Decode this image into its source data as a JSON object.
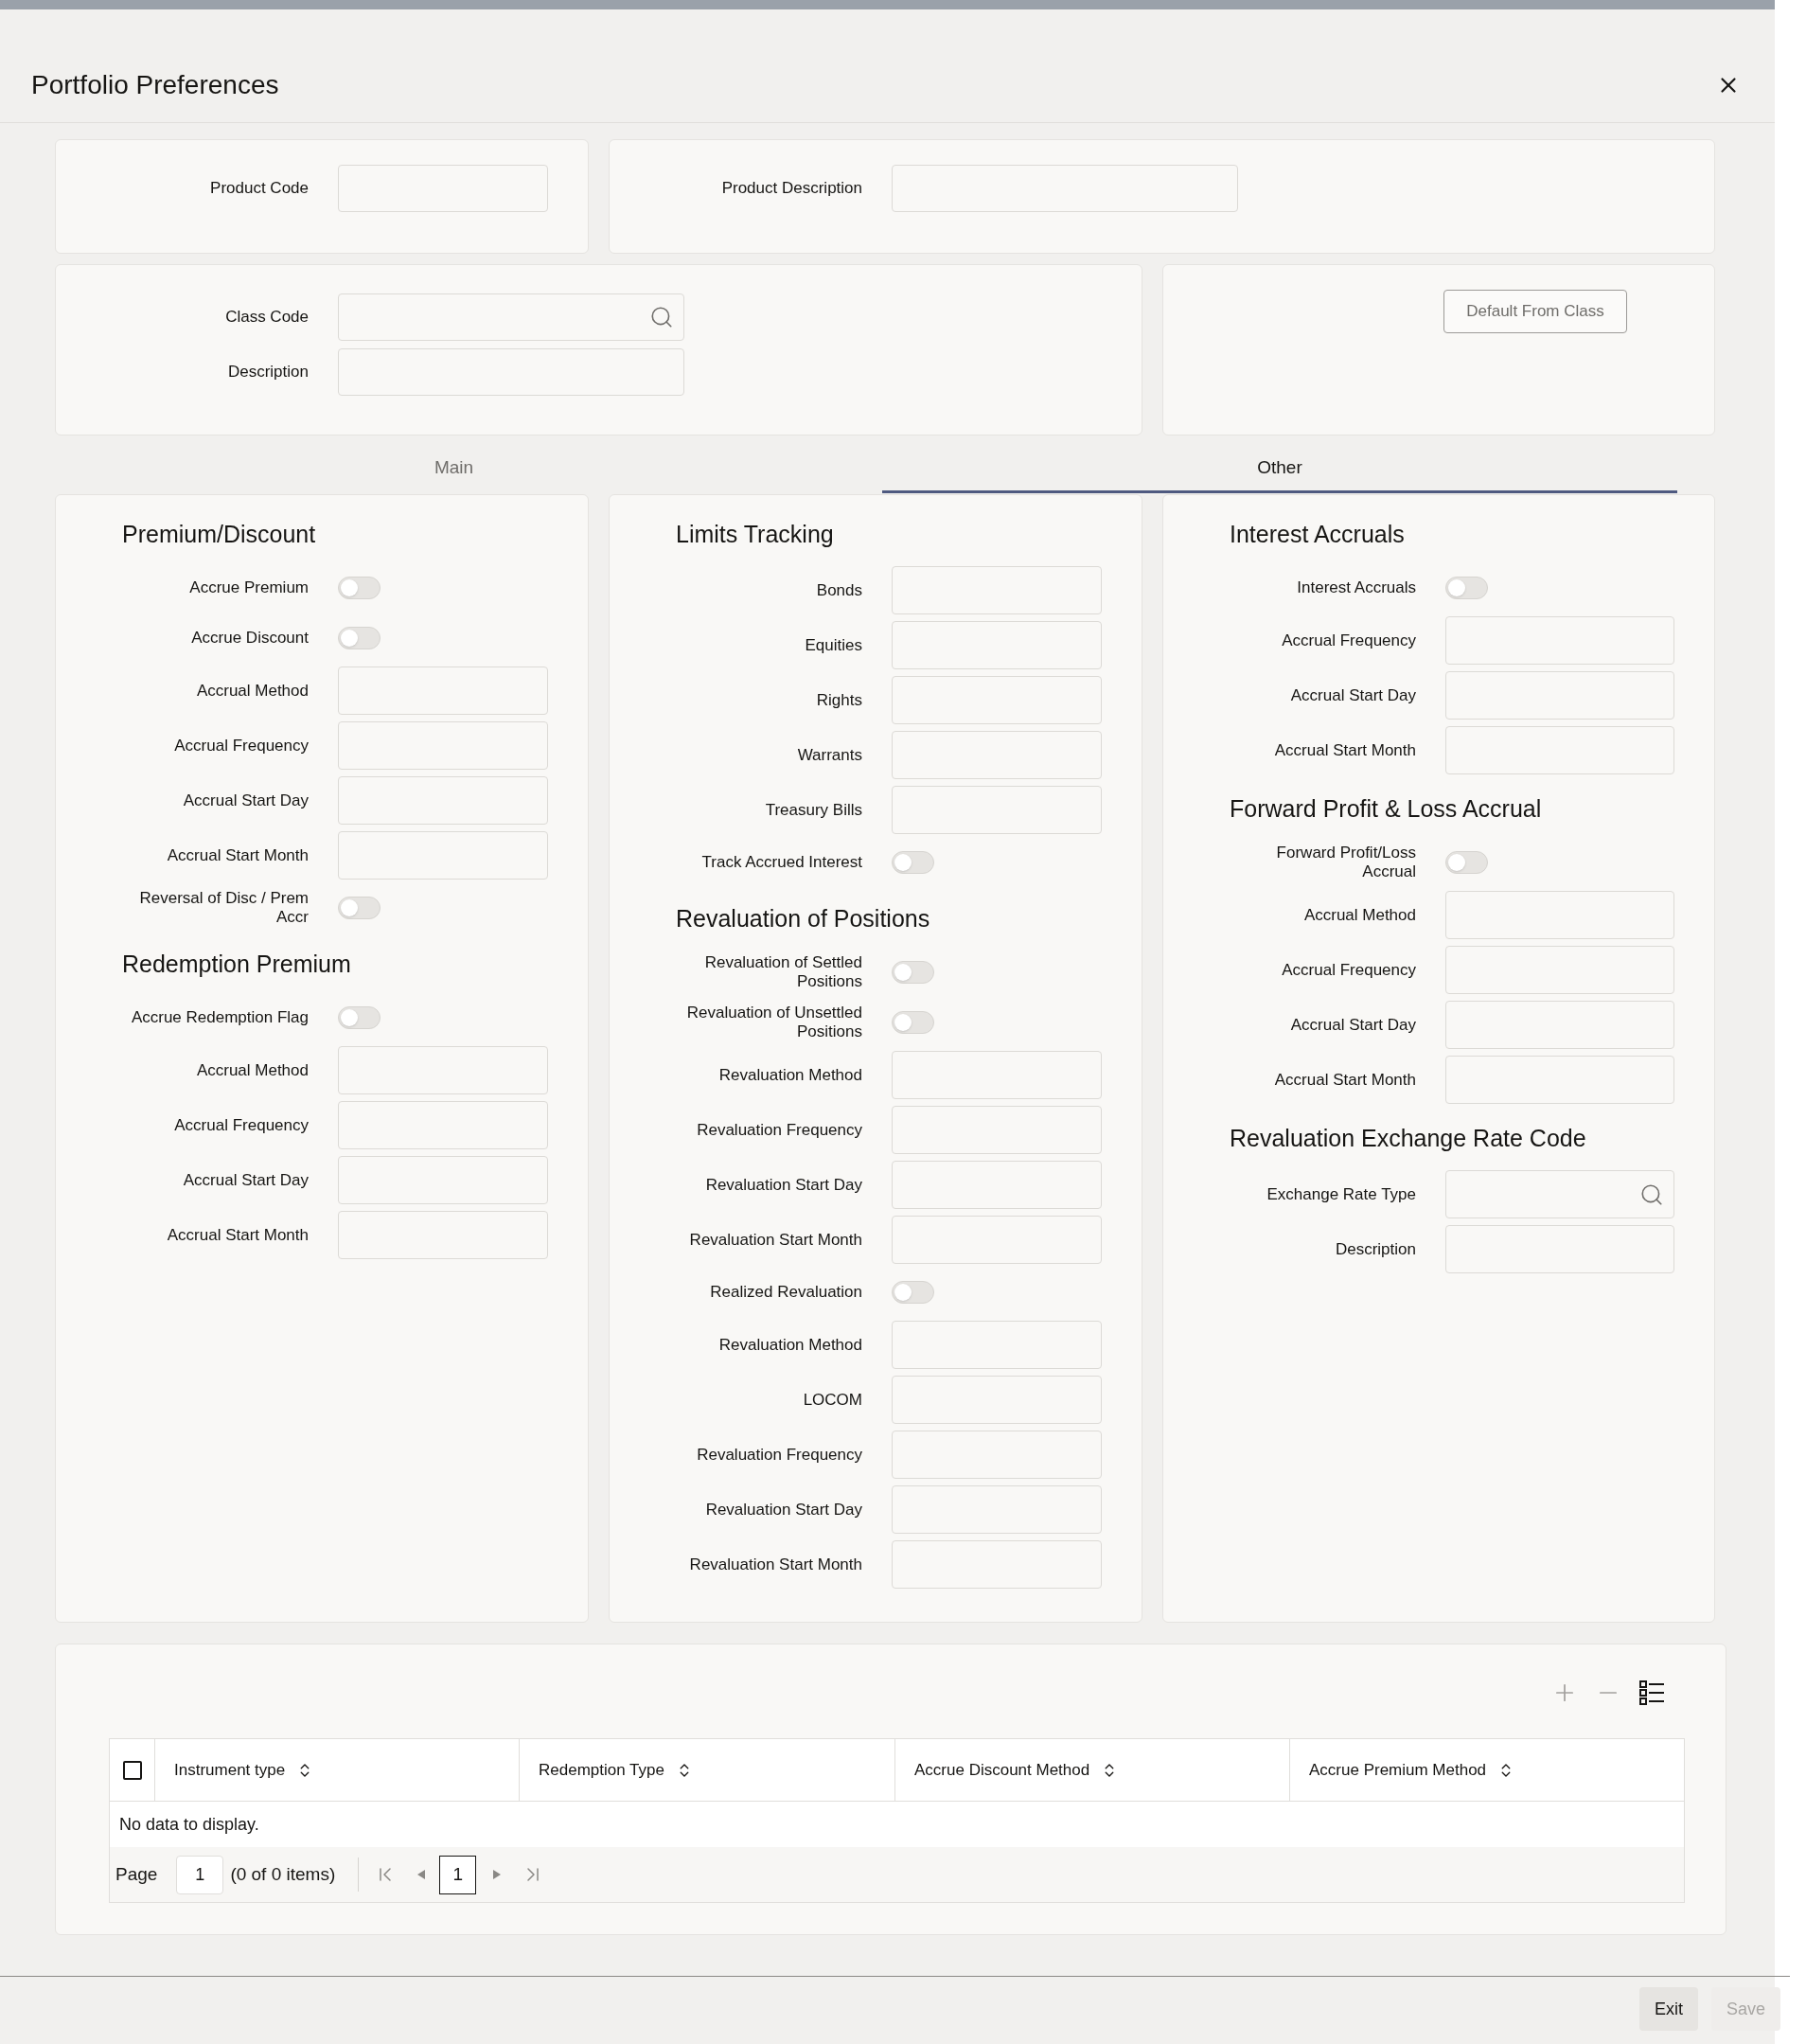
{
  "window": {
    "title": "Portfolio Preferences"
  },
  "product": {
    "fields": [
      {
        "label": "Product Code",
        "kind": "text"
      },
      {
        "label": "Product Description",
        "kind": "text"
      }
    ]
  },
  "class": {
    "fields": [
      {
        "label": "Class Code",
        "kind": "search"
      },
      {
        "label": "Description",
        "kind": "text"
      }
    ],
    "button": "Default From Class"
  },
  "tabs": [
    {
      "label": "Main",
      "selected": false
    },
    {
      "label": "Other",
      "selected": true
    }
  ],
  "columns": [
    {
      "sections": [
        {
          "title": "Premium/Discount",
          "fields": [
            {
              "label": "Accrue Premium",
              "kind": "toggle",
              "on": false
            },
            {
              "label": "Accrue Discount",
              "kind": "toggle",
              "on": false
            },
            {
              "label": "Accrual Method",
              "kind": "text"
            },
            {
              "label": "Accrual Frequency",
              "kind": "text"
            },
            {
              "label": "Accrual Start Day",
              "kind": "text"
            },
            {
              "label": "Accrual Start Month",
              "kind": "text"
            },
            {
              "label": "Reversal of Disc / Prem Accr",
              "kind": "toggle",
              "on": false
            }
          ]
        },
        {
          "title": "Redemption Premium",
          "fields": [
            {
              "label": "Accrue Redemption Flag",
              "kind": "toggle",
              "on": false
            },
            {
              "label": "Accrual Method",
              "kind": "text"
            },
            {
              "label": "Accrual Frequency",
              "kind": "text"
            },
            {
              "label": "Accrual Start Day",
              "kind": "text"
            },
            {
              "label": "Accrual Start Month",
              "kind": "text"
            }
          ]
        }
      ]
    },
    {
      "sections": [
        {
          "title": "Limits Tracking",
          "fields": [
            {
              "label": "Bonds",
              "kind": "text"
            },
            {
              "label": "Equities",
              "kind": "text"
            },
            {
              "label": "Rights",
              "kind": "text"
            },
            {
              "label": "Warrants",
              "kind": "text"
            },
            {
              "label": "Treasury Bills",
              "kind": "text"
            },
            {
              "label": "Track Accrued Interest",
              "kind": "toggle",
              "on": false
            }
          ]
        },
        {
          "title": "Revaluation of Positions",
          "fields": [
            {
              "label": "Revaluation of Settled Positions",
              "kind": "toggle",
              "on": false
            },
            {
              "label": "Revaluation of Unsettled Positions",
              "kind": "toggle",
              "on": false
            },
            {
              "label": "Revaluation Method",
              "kind": "text"
            },
            {
              "label": "Revaluation Frequency",
              "kind": "text"
            },
            {
              "label": "Revaluation Start Day",
              "kind": "text"
            },
            {
              "label": "Revaluation Start Month",
              "kind": "text"
            },
            {
              "label": "Realized Revaluation",
              "kind": "toggle",
              "on": false
            },
            {
              "label": "Revaluation Method",
              "kind": "text"
            },
            {
              "label": "LOCOM",
              "kind": "text"
            },
            {
              "label": "Revaluation Frequency",
              "kind": "text"
            },
            {
              "label": "Revaluation Start Day",
              "kind": "text"
            },
            {
              "label": "Revaluation Start Month",
              "kind": "text"
            }
          ]
        }
      ]
    },
    {
      "sections": [
        {
          "title": "Interest Accruals",
          "fields": [
            {
              "label": "Interest Accruals",
              "kind": "toggle",
              "on": false
            },
            {
              "label": "Accrual Frequency",
              "kind": "text"
            },
            {
              "label": "Accrual Start Day",
              "kind": "text"
            },
            {
              "label": "Accrual Start Month",
              "kind": "text"
            }
          ]
        },
        {
          "title": "Forward Profit & Loss Accrual",
          "fields": [
            {
              "label": "Forward Profit/Loss Accrual",
              "kind": "toggle",
              "on": false
            },
            {
              "label": "Accrual Method",
              "kind": "text"
            },
            {
              "label": "Accrual Frequency",
              "kind": "text"
            },
            {
              "label": "Accrual Start Day",
              "kind": "text"
            },
            {
              "label": "Accrual Start Month",
              "kind": "text"
            }
          ]
        },
        {
          "title": "Revaluation Exchange Rate Code",
          "fields": [
            {
              "label": "Exchange Rate Type",
              "kind": "search"
            },
            {
              "label": "Description",
              "kind": "text"
            }
          ]
        }
      ]
    }
  ],
  "grid": {
    "toolbar": [
      {
        "kind": "add",
        "disabled": true
      },
      {
        "kind": "remove",
        "disabled": true
      },
      {
        "kind": "columns",
        "disabled": false
      }
    ],
    "select_all": {
      "checked": false
    },
    "columns": [
      "Instrument type",
      "Redemption Type",
      "Accrue Discount Method",
      "Accrue Premium Method"
    ],
    "empty_message": "No data to display.",
    "pager": {
      "label": "Page",
      "page": "1",
      "summary": "(0 of 0 items)",
      "pages": [
        {
          "label": "1",
          "selected": true
        }
      ]
    }
  },
  "buttons": [
    {
      "label": "Exit",
      "disabled": false
    },
    {
      "label": "Save",
      "disabled": true
    }
  ]
}
